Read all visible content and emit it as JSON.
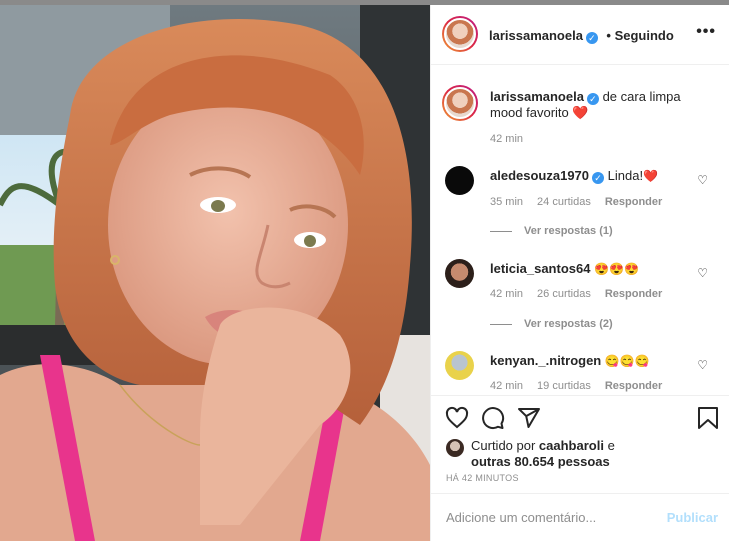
{
  "header": {
    "username": "larissamanoela",
    "follow_state": "• Seguindo",
    "more_label": "•••"
  },
  "caption": {
    "username": "larissamanoela",
    "text_line1": "de cara limpa",
    "text_line2": "mood favorito",
    "time": "42 min"
  },
  "comments": [
    {
      "username": "aledesouza1970",
      "verified": true,
      "text": "Linda!",
      "emoji": "❤️",
      "time": "35 min",
      "likes": "24 curtidas",
      "reply": "Responder",
      "view_replies": "Ver respostas (1)"
    },
    {
      "username": "leticia_santos64",
      "verified": false,
      "text": "",
      "emoji": "😍😍😍",
      "time": "42 min",
      "likes": "26 curtidas",
      "reply": "Responder",
      "view_replies": "Ver respostas (2)"
    },
    {
      "username": "kenyan._.nitrogen",
      "verified": false,
      "text": "",
      "emoji": "😋😋😋",
      "time": "42 min",
      "likes": "19 curtidas",
      "reply": "Responder"
    }
  ],
  "likes": {
    "prefix": "Curtido por ",
    "user": "caahbaroli",
    "mid": " e",
    "others": "outras 80.654 pessoas"
  },
  "timestamp": "HÁ 42 MINUTOS",
  "comment_box": {
    "placeholder": "Adicione um comentário...",
    "publish": "Publicar"
  },
  "colors": {
    "verified": "#3897f0",
    "publish_disabled": "#b2dffc",
    "heart": "#ed4956"
  }
}
